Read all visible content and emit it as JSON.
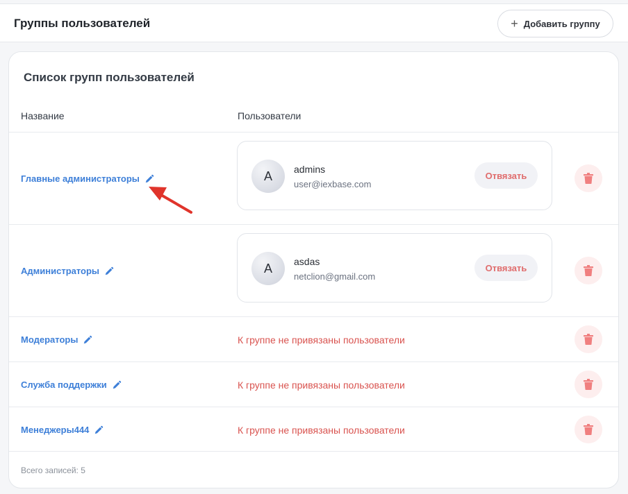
{
  "header": {
    "title": "Группы пользователей",
    "add_group_label": "Добавить группу"
  },
  "card": {
    "title": "Список групп пользователей",
    "columns": {
      "name": "Название",
      "users": "Пользователи"
    }
  },
  "groups": [
    {
      "name": "Главные администраторы",
      "user": {
        "initial": "A",
        "name": "admins",
        "email": "user@iexbase.com",
        "unbind_label": "Отвязать"
      }
    },
    {
      "name": "Администраторы",
      "user": {
        "initial": "A",
        "name": "asdas",
        "email": "netclion@gmail.com",
        "unbind_label": "Отвязать"
      }
    },
    {
      "name": "Модераторы",
      "empty_message": "К группе не привязаны пользователи"
    },
    {
      "name": "Служба поддержки",
      "empty_message": "К группе не привязаны пользователи"
    },
    {
      "name": "Менеджеры444",
      "empty_message": "К группе не привязаны пользователи"
    }
  ],
  "footer": {
    "total_label": "Всего записей: 5"
  },
  "colors": {
    "link": "#3d7fd8",
    "danger": "#d9534f",
    "arrow": "#e0342b"
  },
  "icons": {
    "edit": "pencil-icon",
    "delete": "trash-icon",
    "add": "plus-icon"
  }
}
